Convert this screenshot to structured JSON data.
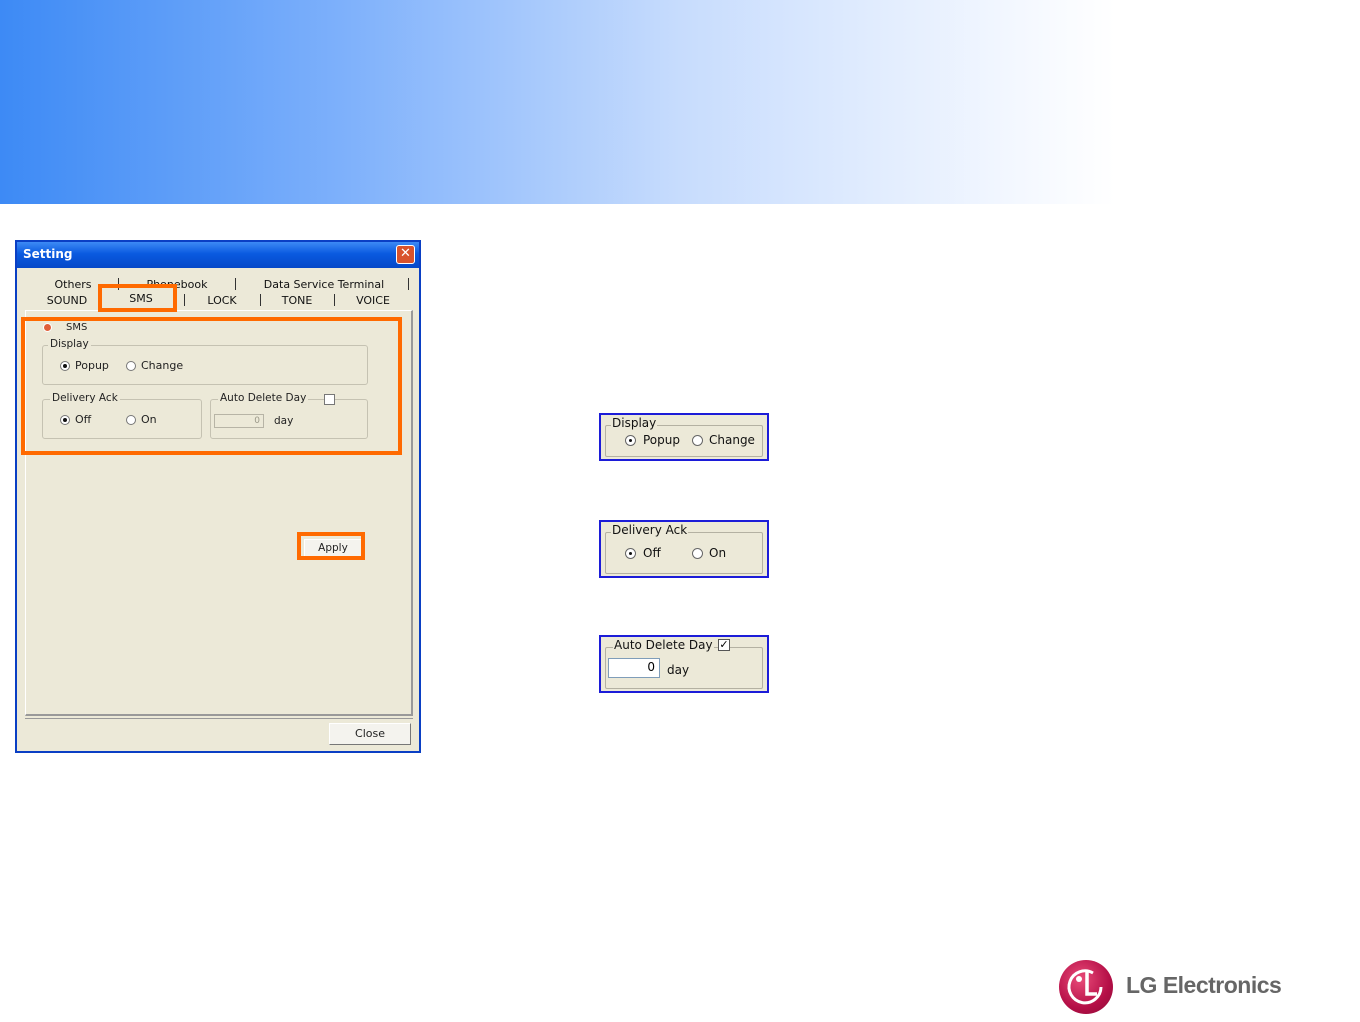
{
  "dialog": {
    "title": "Setting",
    "close_glyph": "✕",
    "tabs_row1": [
      "Others",
      "Phonebook",
      "Data Service Terminal"
    ],
    "tabs_row2": [
      "SOUND",
      "SMS",
      "LOCK",
      "TONE",
      "VOICE"
    ],
    "active_tab": "SMS",
    "section_label": "SMS",
    "display": {
      "label": "Display",
      "options": [
        "Popup",
        "Change"
      ],
      "selected": "Popup"
    },
    "delivery_ack": {
      "label": "Delivery Ack",
      "options": [
        "Off",
        "On"
      ],
      "selected": "Off"
    },
    "auto_delete": {
      "label": "Auto Delete Day",
      "checked": false,
      "value": "0",
      "unit": "day"
    },
    "apply_label": "Apply",
    "close_label": "Close"
  },
  "details": {
    "display": {
      "label": "Display",
      "options": [
        "Popup",
        "Change"
      ],
      "selected": "Popup"
    },
    "delivery_ack": {
      "label": "Delivery Ack",
      "options": [
        "Off",
        "On"
      ],
      "selected": "Off"
    },
    "auto_delete": {
      "label": "Auto Delete Day",
      "checked": true,
      "value": "0",
      "unit": "day"
    }
  },
  "logo": {
    "text": "LG Electronics",
    "icon": "lg-logo-icon"
  },
  "colors": {
    "highlight_orange": "#ff6a00",
    "highlight_blue": "#1c1cd8",
    "banner_blue": "#3d8af5",
    "dialog_bg": "#ece9d8",
    "lg_red": "#b50f47"
  }
}
